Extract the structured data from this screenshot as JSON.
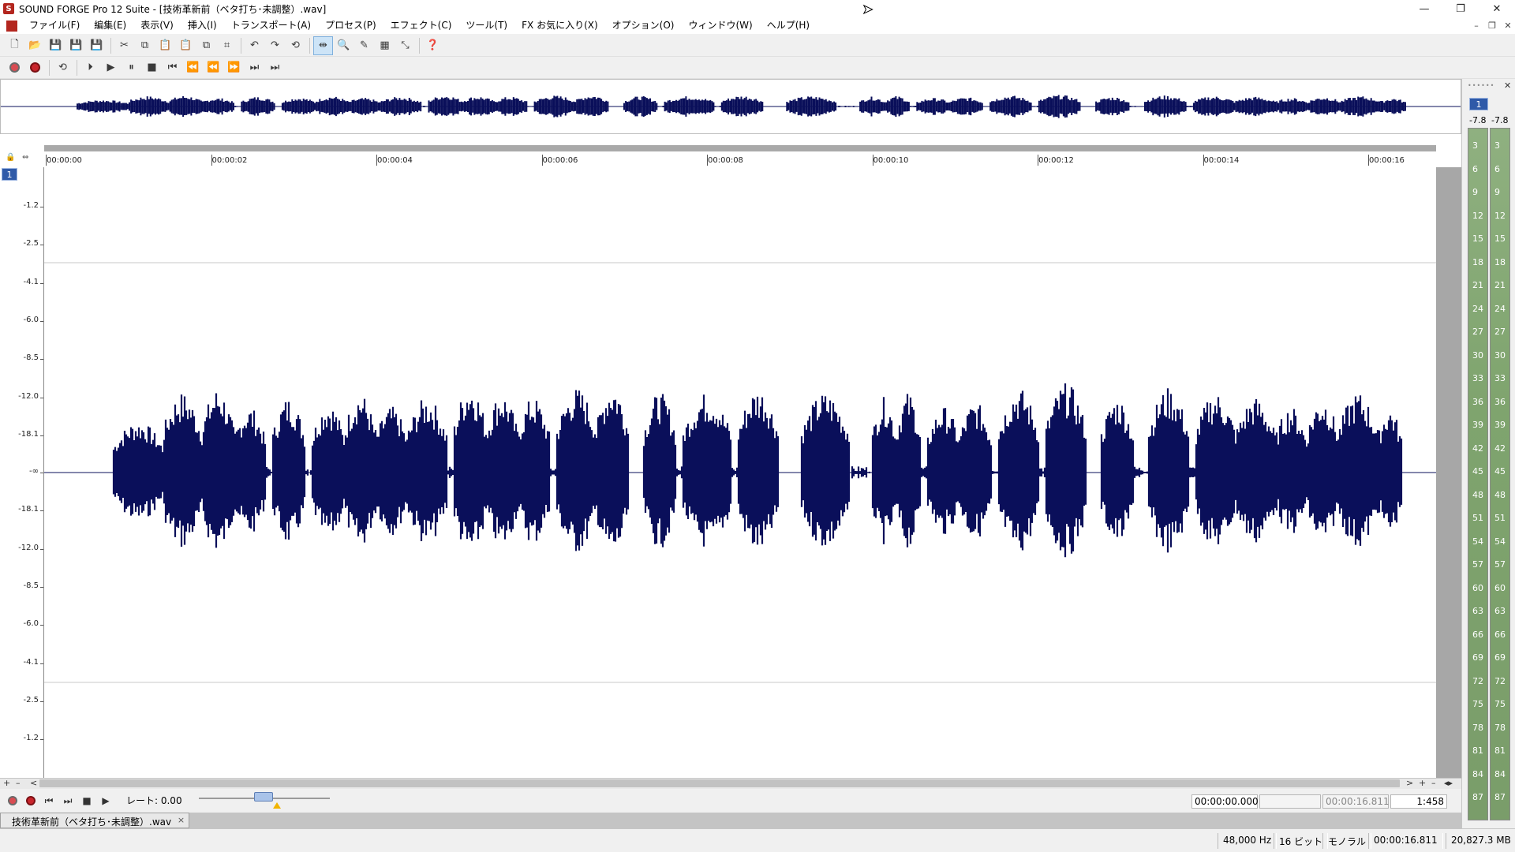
{
  "window": {
    "title": "SOUND FORGE Pro 12 Suite - [技術革新前（ベタ打ち･未調整）.wav]",
    "logo": "S",
    "controls": [
      "—",
      "❐",
      "✕"
    ]
  },
  "menu": {
    "items": [
      "ファイル(F)",
      "編集(E)",
      "表示(V)",
      "挿入(I)",
      "トランスポート(A)",
      "プロセス(P)",
      "エフェクト(C)",
      "ツール(T)",
      "FX お気に入り(X)",
      "オプション(O)",
      "ウィンドウ(W)",
      "ヘルプ(H)"
    ],
    "mdi_controls": [
      "–",
      "❐",
      "✕"
    ]
  },
  "toolbar_main": [
    {
      "name": "new-file-icon",
      "glyph": "🗋"
    },
    {
      "name": "open-file-icon",
      "glyph": "📂"
    },
    {
      "name": "save-icon",
      "glyph": "💾"
    },
    {
      "name": "save-as-icon",
      "glyph": "💾"
    },
    {
      "name": "save-all-icon",
      "glyph": "💾"
    },
    {
      "name": "cut-icon",
      "glyph": "✂"
    },
    {
      "name": "copy-icon",
      "glyph": "⧉"
    },
    {
      "name": "paste-icon",
      "glyph": "📋"
    },
    {
      "name": "mix-paste-icon",
      "glyph": "📋"
    },
    {
      "name": "crossfade-icon",
      "glyph": "⧉"
    },
    {
      "name": "crop-icon",
      "glyph": "⌗"
    },
    {
      "name": "undo-icon",
      "glyph": "↶"
    },
    {
      "name": "redo-icon",
      "glyph": "↷"
    },
    {
      "name": "repeat-icon",
      "glyph": "⟲"
    },
    {
      "name": "edit-tool-icon",
      "glyph": "⇹"
    },
    {
      "name": "magnify-tool-icon",
      "glyph": "🔍"
    },
    {
      "name": "pencil-tool-icon",
      "glyph": "✎"
    },
    {
      "name": "event-tool-icon",
      "glyph": "▦"
    },
    {
      "name": "envelope-tool-icon",
      "glyph": "⤡"
    },
    {
      "name": "help-pointer-icon",
      "glyph": "❓"
    }
  ],
  "toolbar_transport": [
    {
      "name": "record-icon",
      "glyph": "⏺"
    },
    {
      "name": "record-mode-icon",
      "glyph": "⏺"
    },
    {
      "name": "loop-icon",
      "glyph": "⟲"
    },
    {
      "name": "play-all-icon",
      "glyph": "⏵"
    },
    {
      "name": "play-icon",
      "glyph": "▶"
    },
    {
      "name": "pause-icon",
      "glyph": "⏸"
    },
    {
      "name": "stop-icon",
      "glyph": "■"
    },
    {
      "name": "go-to-start-icon",
      "glyph": "⏮"
    },
    {
      "name": "rewind-icon",
      "glyph": "⏪"
    },
    {
      "name": "rewind-fast-icon",
      "glyph": "⏪"
    },
    {
      "name": "forward-icon",
      "glyph": "⏩"
    },
    {
      "name": "forward-fast-icon",
      "glyph": "⏭"
    },
    {
      "name": "go-to-end-icon",
      "glyph": "⏭"
    }
  ],
  "ruler": {
    "labels": [
      "00:00:00",
      "00:00:02",
      "00:00:04",
      "00:00:06",
      "00:00:08",
      "00:00:10",
      "00:00:12",
      "00:00:14",
      "00:00:16"
    ],
    "lock_glyph": "🔒",
    "snap_glyph": "⇔"
  },
  "waveform": {
    "channel": "1",
    "y_labels_top": [
      "-1.2",
      "-2.5",
      "-4.1",
      "-6.0",
      "-8.5",
      "-12.0",
      "-18.1"
    ],
    "center_label": "-∞",
    "y_labels_bottom": [
      "-18.1",
      "-12.0",
      "-8.5",
      "-6.0",
      "-4.1",
      "-2.5",
      "-1.2"
    ],
    "color": "#0a0f5a"
  },
  "scroll": {
    "left_buttons": [
      "+",
      "–",
      "<"
    ],
    "right_buttons": [
      ">",
      "+",
      "–",
      "◂▸"
    ]
  },
  "transport_bar": {
    "rate_label": "レート: 0.00",
    "time_start": "00:00:00.000",
    "time_blank": "",
    "time_length": "00:00:16.811",
    "zoom": "1:458",
    "buttons": [
      "⏺",
      "⏺",
      "⏮",
      "⏭",
      "■",
      "▶"
    ]
  },
  "tab": {
    "label": "技術革新前（ベタ打ち･未調整）.wav",
    "close": "×"
  },
  "status": {
    "sample_rate": "48,000 Hz",
    "bit_depth": "16 ビット",
    "channels": "モノラル",
    "length": "00:00:16.811",
    "free_space": "20,827.3 MB"
  },
  "meters": {
    "grip": "••••••",
    "close": "✕",
    "channel": "1",
    "peak_left": "-7.8",
    "peak_right": "-7.8",
    "scale": [
      "3",
      "6",
      "9",
      "12",
      "15",
      "18",
      "21",
      "24",
      "27",
      "30",
      "33",
      "36",
      "39",
      "42",
      "45",
      "48",
      "51",
      "54",
      "57",
      "60",
      "63",
      "66",
      "69",
      "72",
      "75",
      "78",
      "81",
      "84",
      "87"
    ]
  }
}
